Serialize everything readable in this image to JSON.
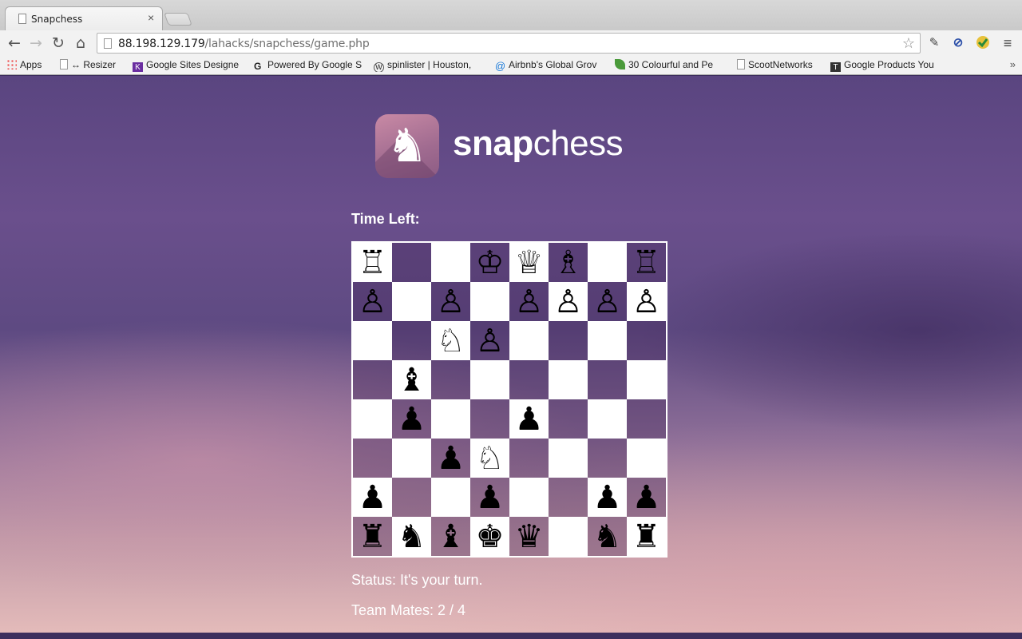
{
  "browser": {
    "tab_title": "Snapchess",
    "tab_close": "×",
    "url_host": "88.198.129.179",
    "url_path": "/lahacks/snapchess/game.php",
    "bookmarks": [
      {
        "label": "Apps",
        "icon": "apps-grid-icon"
      },
      {
        "label": "↔ Resizer",
        "icon": "page-icon"
      },
      {
        "label": "Google Sites Designe",
        "icon": "k-logo-icon"
      },
      {
        "label": "Powered By Google S",
        "icon": "g-logo-icon"
      },
      {
        "label": "spinlister | Houston,",
        "icon": "wordpress-icon"
      },
      {
        "label": "Airbnb's Global Grov",
        "icon": "airbnb-icon"
      },
      {
        "label": "30 Colourful and Pe",
        "icon": "leaf-icon"
      },
      {
        "label": "ScootNetworks",
        "icon": "page-icon"
      },
      {
        "label": "Google Products You",
        "icon": "t-logo-icon"
      }
    ],
    "more": "»"
  },
  "app": {
    "logo_text_bold": "snap",
    "logo_text_rest": "chess",
    "time_left_label": "Time Left:",
    "status_text": "Status: It's your turn.",
    "team_mates_text": "Team Mates: 2 / 4"
  },
  "board": {
    "rows": [
      [
        "♖",
        "",
        "",
        "♔",
        "♕",
        "♗",
        "",
        "♖"
      ],
      [
        "♙",
        "",
        "♙",
        "",
        "♙",
        "♙",
        "♙",
        "♙"
      ],
      [
        "",
        "",
        "♘",
        "♙",
        "",
        "",
        "",
        ""
      ],
      [
        "",
        "♝",
        "",
        "",
        "",
        "",
        "",
        ""
      ],
      [
        "",
        "♟",
        "",
        "",
        "♟",
        "",
        "",
        ""
      ],
      [
        "",
        "",
        "♟",
        "♘",
        "",
        "",
        "",
        ""
      ],
      [
        "♟",
        "",
        "",
        "♟",
        "",
        "",
        "♟",
        "♟"
      ],
      [
        "♜",
        "♞",
        "♝",
        "♚",
        "♛",
        "",
        "♞",
        "♜"
      ]
    ],
    "light_color": "#ffffff",
    "dark_color": "#6b4f86"
  }
}
